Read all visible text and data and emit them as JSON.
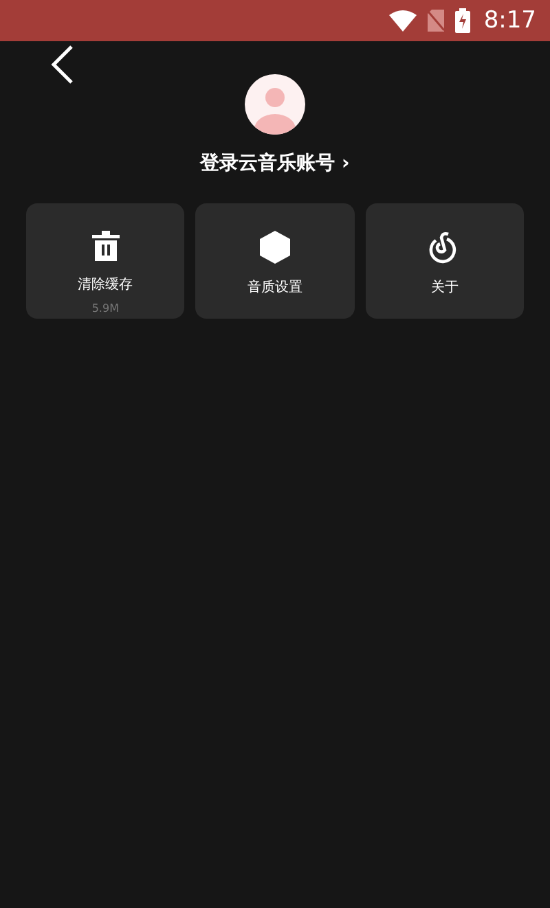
{
  "status_bar": {
    "time": "8:17"
  },
  "account": {
    "label": "登录云音乐账号 ›"
  },
  "cards": [
    {
      "kind": "trash",
      "label": "清除缓存",
      "detail": "5.9M"
    },
    {
      "kind": "hexagon",
      "label": "音质设置"
    },
    {
      "kind": "logo",
      "label": "关于"
    }
  ]
}
